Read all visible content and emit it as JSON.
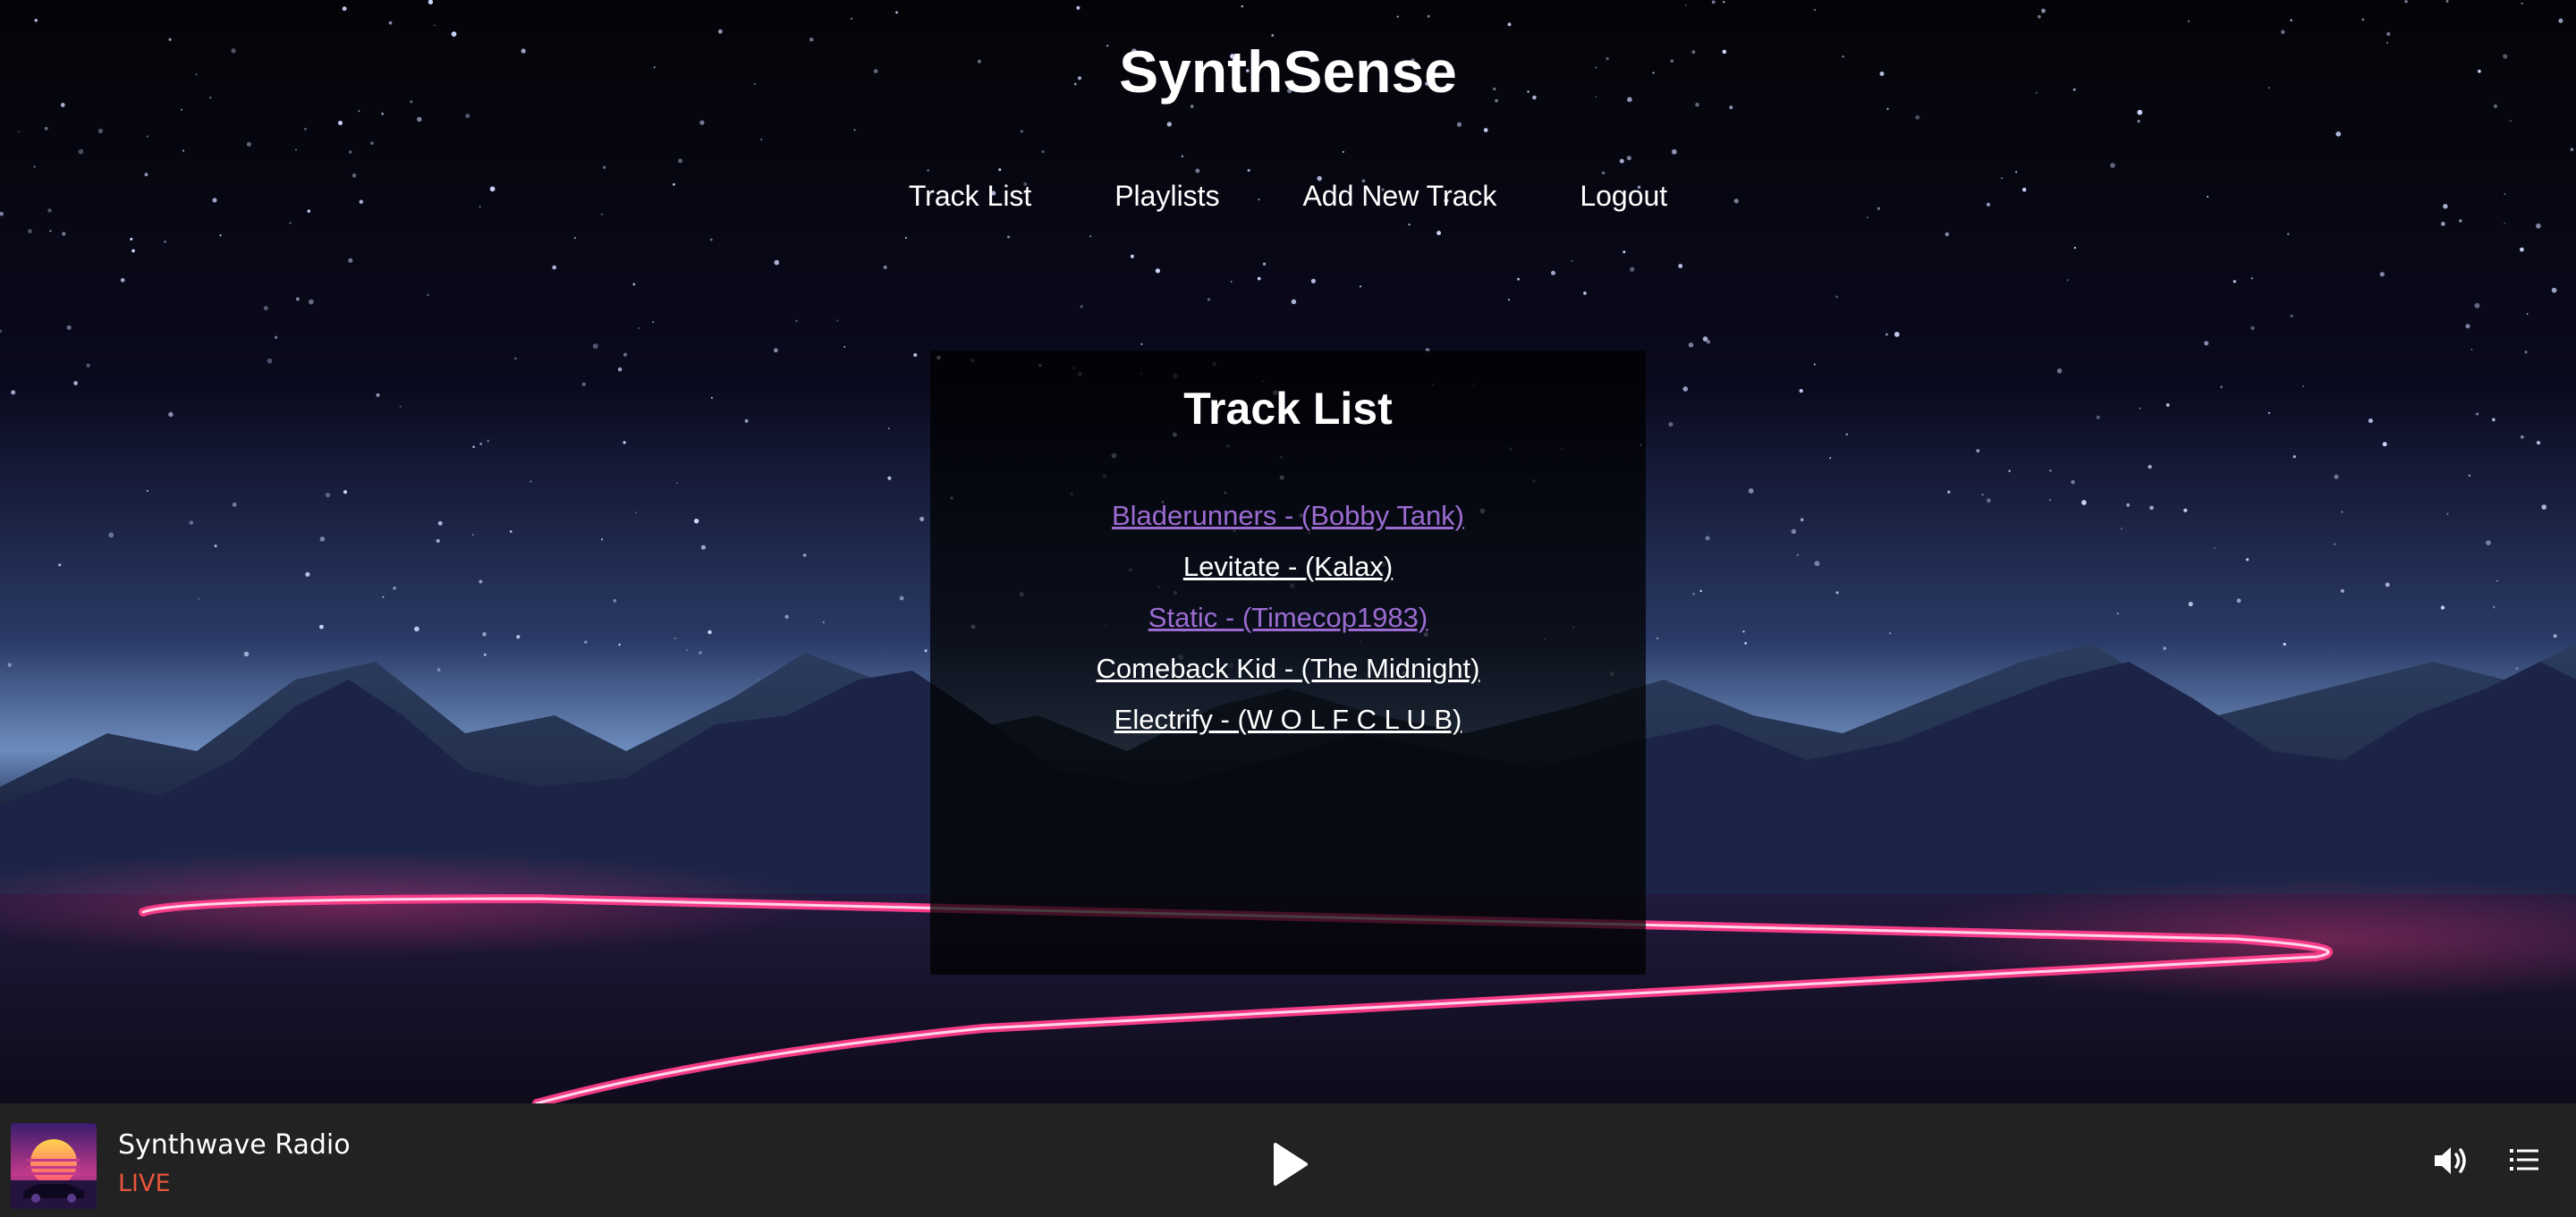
{
  "header": {
    "site_title": "SynthSense"
  },
  "nav": {
    "items": [
      {
        "label": "Track List"
      },
      {
        "label": "Playlists"
      },
      {
        "label": "Add New Track"
      },
      {
        "label": "Logout"
      }
    ]
  },
  "main": {
    "heading": "Track List",
    "tracks": [
      {
        "label": "Bladerunners - (Bobby Tank)",
        "visited": true
      },
      {
        "label": "Levitate - (Kalax)",
        "visited": false
      },
      {
        "label": "Static - (Timecop1983)",
        "visited": true
      },
      {
        "label": "Comeback Kid - (The Midnight)",
        "visited": false
      },
      {
        "label": "Electrify - (W O L F C L U B)",
        "visited": false
      }
    ]
  },
  "player": {
    "station": "Synthwave Radio",
    "status": "LIVE",
    "controls": {
      "play_icon": "play-icon",
      "volume_icon": "volume-icon",
      "queue_icon": "queue-list-icon"
    }
  },
  "colors": {
    "link": "#ffffff",
    "link_visited": "#9b6bd1",
    "live": "#e8553c",
    "player_bg": "#222222",
    "neon_pink": "#ff3d8b"
  }
}
